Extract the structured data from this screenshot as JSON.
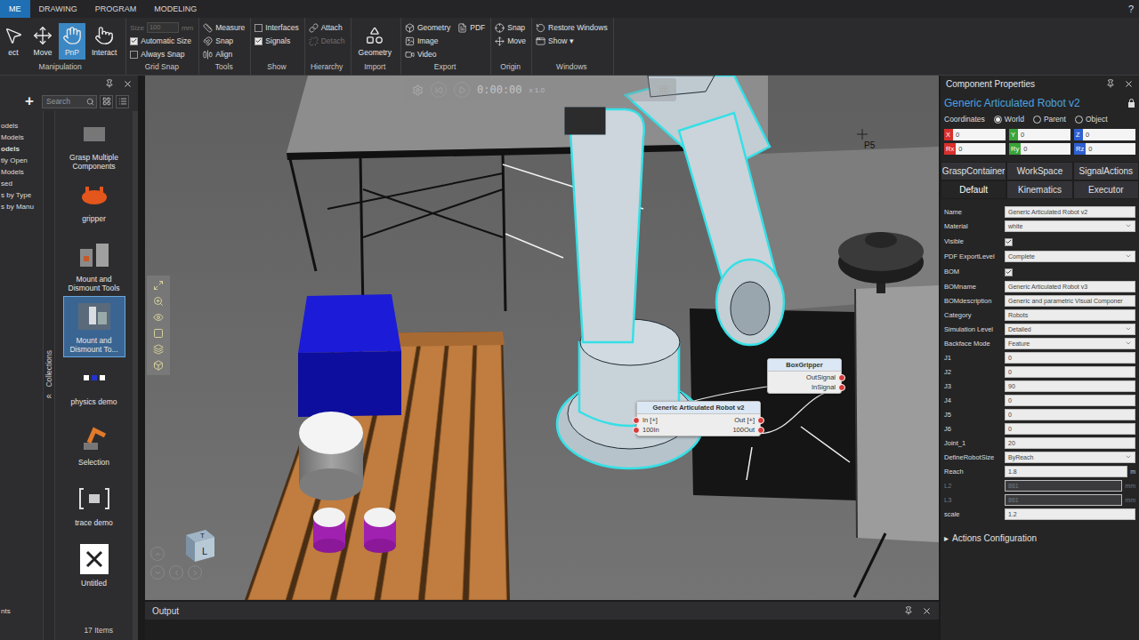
{
  "app": {
    "help": "?"
  },
  "ribbon": {
    "tabs": [
      {
        "label": "ME",
        "selected": true
      },
      {
        "label": "DRAWING",
        "selected": false
      },
      {
        "label": "PROGRAM",
        "selected": false
      },
      {
        "label": "MODELING",
        "selected": false
      }
    ],
    "groups": [
      {
        "label": "Manipulation",
        "items": [
          {
            "label": "ect",
            "kind": "large",
            "selected": false
          },
          {
            "label": "Move",
            "kind": "large",
            "selected": false
          },
          {
            "label": "PnP",
            "kind": "large",
            "selected": true
          },
          {
            "label": "Interact",
            "kind": "large",
            "selected": false
          }
        ]
      },
      {
        "label": "Grid Snap",
        "items": [
          {
            "label": "Size",
            "kind": "field",
            "value": "100",
            "unit": "mm",
            "disabled": true
          },
          {
            "label": "Automatic Size",
            "kind": "check",
            "checked": true
          },
          {
            "label": "Always Snap",
            "kind": "check",
            "checked": false
          }
        ]
      },
      {
        "label": "Tools",
        "items": [
          {
            "label": "Measure",
            "kind": "small",
            "disabled": false
          },
          {
            "label": "Snap",
            "kind": "small",
            "disabled": false
          },
          {
            "label": "Align",
            "kind": "small",
            "disabled": false
          }
        ]
      },
      {
        "label": "Show",
        "items": [
          {
            "label": "Interfaces",
            "kind": "check",
            "checked": false
          },
          {
            "label": "Signals",
            "kind": "check",
            "checked": true
          }
        ]
      },
      {
        "label": "Hierarchy",
        "items": [
          {
            "label": "Attach",
            "kind": "small",
            "disabled": false
          },
          {
            "label": "Detach",
            "kind": "small",
            "disabled": true
          }
        ]
      },
      {
        "label": "Import",
        "items": [
          {
            "label": "Geometry",
            "kind": "large",
            "selected": false
          }
        ]
      },
      {
        "label": "Export",
        "items": [
          {
            "label": "Geometry",
            "kind": "small",
            "disabled": false
          },
          {
            "label": "Image",
            "kind": "small",
            "disabled": false
          },
          {
            "label": "Video",
            "kind": "small",
            "disabled": false
          },
          {
            "label": "PDF",
            "kind": "small",
            "disabled": false
          }
        ]
      },
      {
        "label": "Origin",
        "items": [
          {
            "label": "Snap",
            "kind": "small",
            "disabled": false
          },
          {
            "label": "Move",
            "kind": "small",
            "disabled": false
          }
        ]
      },
      {
        "label": "Windows",
        "items": [
          {
            "label": "Restore Windows",
            "kind": "small",
            "disabled": false
          },
          {
            "label": "Show ▾",
            "kind": "small",
            "disabled": false
          }
        ]
      }
    ]
  },
  "library": {
    "add": "+",
    "search": {
      "placeholder": "Search"
    },
    "tree": [
      {
        "label": "odels",
        "selected": false
      },
      {
        "label": "Models",
        "selected": false
      },
      {
        "label": "odels",
        "selected": true
      },
      {
        "label": "tly Open",
        "selected": false
      },
      {
        "label": "Models",
        "selected": false
      },
      {
        "label": "sed",
        "selected": false
      },
      {
        "label": "s by Type",
        "selected": false
      },
      {
        "label": "s by Manu",
        "selected": false
      }
    ],
    "tree_footer": "nts",
    "collections_tab": "Collections",
    "collapse": "«",
    "items": [
      {
        "label": "Grasp Multiple Components",
        "selected": false
      },
      {
        "label": "gripper",
        "selected": false
      },
      {
        "label": "Mount and Dismount Tools",
        "selected": false
      },
      {
        "label": "Mount and Dismount To...",
        "selected": true
      },
      {
        "label": "physics demo",
        "selected": false
      },
      {
        "label": "Selection",
        "selected": false
      },
      {
        "label": "trace demo",
        "selected": false
      },
      {
        "label": "Untitled",
        "selected": false
      }
    ],
    "count": "17 Items"
  },
  "viewport": {
    "playback": {
      "time": "0:00:00",
      "speed": "x 1.0"
    },
    "label": "P5",
    "view_cube": {
      "top": "T",
      "front": "L"
    },
    "nodes": [
      {
        "title": "Generic Articulated Robot v2",
        "inputs": [
          "In [+]",
          "100In"
        ],
        "outputs": [
          "Out [+]",
          "100Out"
        ]
      },
      {
        "title": "BoxGripper",
        "inputs": [],
        "outputs": [
          "OutSignal",
          "InSignal"
        ]
      }
    ]
  },
  "output": {
    "title": "Output"
  },
  "properties": {
    "title": "Component Properties",
    "component": "Generic Articulated Robot v2",
    "coordinates": {
      "label": "Coordinates",
      "options": [
        {
          "label": "World",
          "selected": true
        },
        {
          "label": "Parent",
          "selected": false
        },
        {
          "label": "Object",
          "selected": false
        }
      ]
    },
    "fields": [
      {
        "label": "X",
        "value": "0",
        "color": "#d9302c"
      },
      {
        "label": "Y",
        "value": "0",
        "color": "#3aa53a"
      },
      {
        "label": "Z",
        "value": "0",
        "color": "#2f5fd0"
      },
      {
        "label": "Rx",
        "value": "0",
        "color": "#d9302c"
      },
      {
        "label": "Ry",
        "value": "0",
        "color": "#3aa53a"
      },
      {
        "label": "Rz",
        "value": "0",
        "color": "#2f5fd0"
      }
    ],
    "tabs_top": [
      {
        "label": "GraspContainer",
        "selected": false
      },
      {
        "label": "WorkSpace",
        "selected": false
      },
      {
        "label": "SignalActions",
        "selected": false
      }
    ],
    "tabs": [
      {
        "label": "Default",
        "selected": true
      },
      {
        "label": "Kinematics",
        "selected": false
      },
      {
        "label": "Executor",
        "selected": false
      }
    ],
    "rows": [
      {
        "label": "Name",
        "kind": "text",
        "value": "Generic Articulated Robot v2",
        "disabled": false
      },
      {
        "label": "Material",
        "kind": "select",
        "value": "white",
        "disabled": false
      },
      {
        "label": "Visible",
        "kind": "check",
        "checked": true,
        "disabled": false
      },
      {
        "label": "PDF ExportLevel",
        "kind": "select",
        "value": "Complete",
        "disabled": false
      },
      {
        "label": "BOM",
        "kind": "check",
        "checked": true,
        "disabled": false
      },
      {
        "label": "BOMname",
        "kind": "text",
        "value": "Generic Articulated Robot v3",
        "disabled": false
      },
      {
        "label": "BOMdescription",
        "kind": "text",
        "value": "Generic and parametric Visual Componer",
        "disabled": false
      },
      {
        "label": "Category",
        "kind": "text",
        "value": "Robots",
        "disabled": false
      },
      {
        "label": "Simulation Level",
        "kind": "select",
        "value": "Detailed",
        "disabled": false
      },
      {
        "label": "Backface Mode",
        "kind": "select",
        "value": "Feature",
        "disabled": false
      },
      {
        "label": "J1",
        "kind": "text",
        "value": "0",
        "disabled": false
      },
      {
        "label": "J2",
        "kind": "text",
        "value": "0",
        "disabled": false
      },
      {
        "label": "J3",
        "kind": "text",
        "value": "90",
        "disabled": false
      },
      {
        "label": "J4",
        "kind": "text",
        "value": "0",
        "disabled": false
      },
      {
        "label": "J5",
        "kind": "text",
        "value": "0",
        "disabled": false
      },
      {
        "label": "J6",
        "kind": "text",
        "value": "0",
        "disabled": false
      },
      {
        "label": "Joint_1",
        "kind": "text",
        "value": "20",
        "disabled": false
      },
      {
        "label": "DefineRobotSize",
        "kind": "select",
        "value": "ByReach",
        "disabled": false
      },
      {
        "label": "Reach",
        "kind": "unit",
        "value": "1.8",
        "unit": "m",
        "disabled": false
      },
      {
        "label": "L2",
        "kind": "unit",
        "value": "861",
        "unit": "mm",
        "disabled": true
      },
      {
        "label": "L3",
        "kind": "unit",
        "value": "861",
        "unit": "mm",
        "disabled": true
      },
      {
        "label": "scale",
        "kind": "text",
        "value": "1.2",
        "disabled": false
      }
    ],
    "section": {
      "label": "Actions Configuration",
      "marker": "▸",
      "expanded": false
    }
  }
}
